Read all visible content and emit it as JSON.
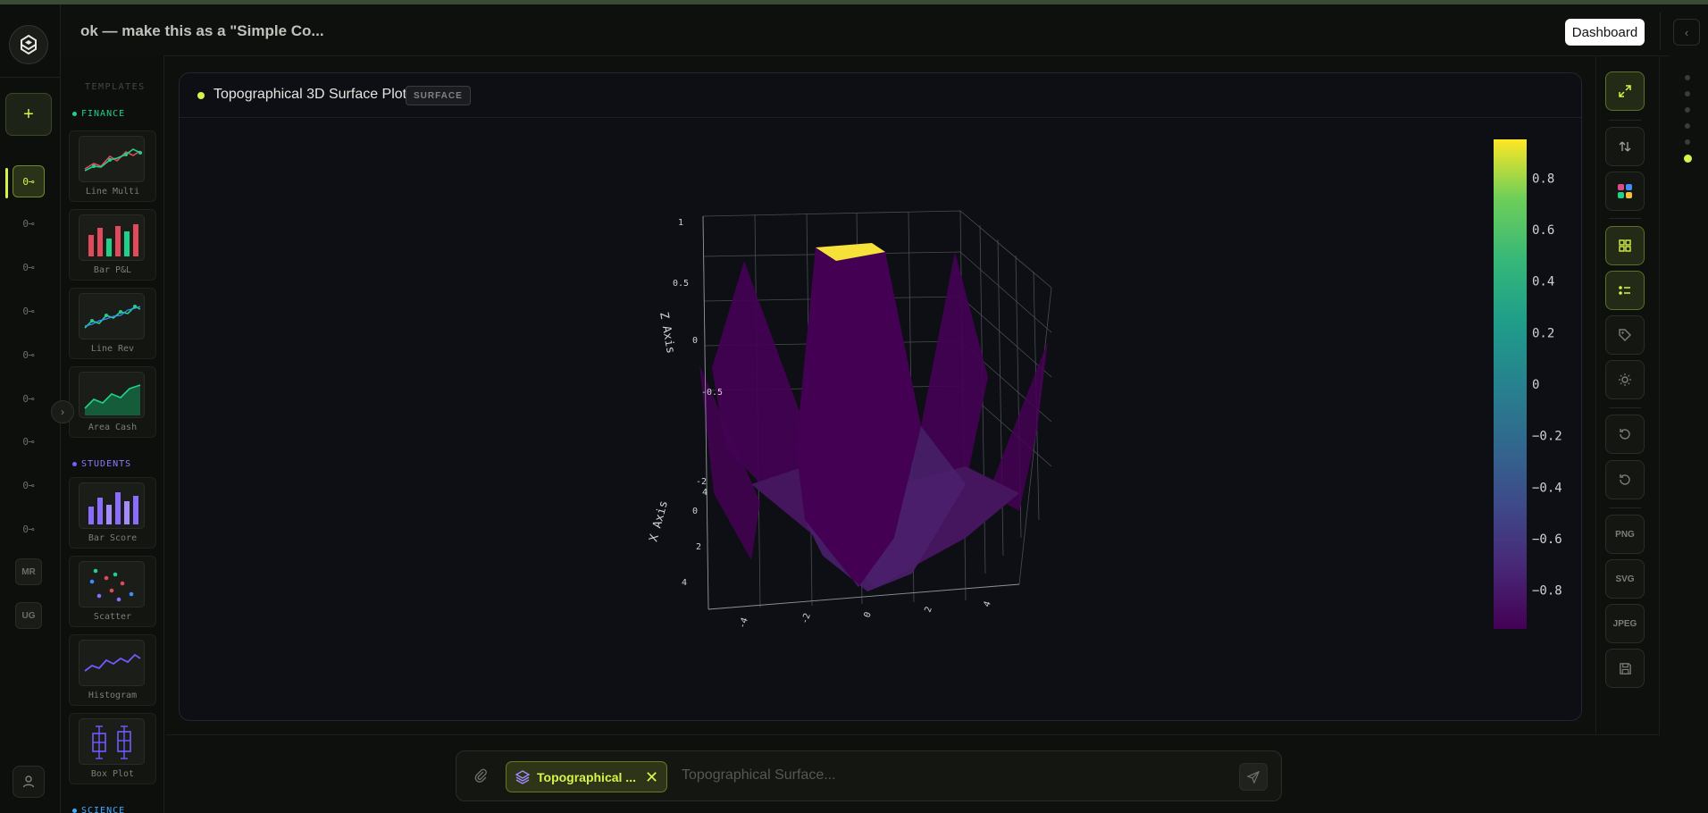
{
  "header": {
    "title": "ok — make this as a \"Simple Co...",
    "dashboard_label": "Dashboard",
    "collapse_glyph": "‹"
  },
  "rail": {
    "add_glyph": "+",
    "key_glyph": "0⊸",
    "initials": [
      "MR",
      "UG"
    ]
  },
  "templates": {
    "heading": "TEMPLATES",
    "sections": [
      {
        "name": "FINANCE",
        "color": "#1fd18a",
        "items": [
          "Line Multi",
          "Bar P&L",
          "Line Rev",
          "Area Cash"
        ]
      },
      {
        "name": "STUDENTS",
        "color": "#7b5cff",
        "items": [
          "Bar Score",
          "Scatter",
          "Histogram",
          "Box Plot"
        ]
      },
      {
        "name": "SCIENCE",
        "color": "#3fa9ff",
        "items": []
      }
    ],
    "expand_glyph": "›"
  },
  "panel": {
    "title": "Topographical 3D Surface Plot",
    "badge": "SURFACE"
  },
  "chart_data": {
    "type": "surface",
    "title": "",
    "xlabel": "X Axis",
    "ylabel": "",
    "zlabel": "Z Axis",
    "x_ticks": [
      "4",
      "2",
      "0",
      "-2",
      "-4"
    ],
    "y_ticks": [
      "-4",
      "-2",
      "0",
      "2",
      "4"
    ],
    "z_ticks": [
      "1",
      "0.5",
      "0",
      "-0.5"
    ],
    "colorscale": "viridis",
    "colorbar_ticks": [
      "0.8",
      "0.6",
      "0.4",
      "0.2",
      "0",
      "−0.2",
      "−0.4",
      "−0.6",
      "−0.8"
    ],
    "colorbar_range": [
      -0.95,
      0.95
    ],
    "grid": true
  },
  "toolbar": {
    "png": "PNG",
    "svg": "SVG",
    "jpeg": "JPEG"
  },
  "composer": {
    "chip_label": "Topographical ...",
    "placeholder": "Topographical Surface..."
  }
}
